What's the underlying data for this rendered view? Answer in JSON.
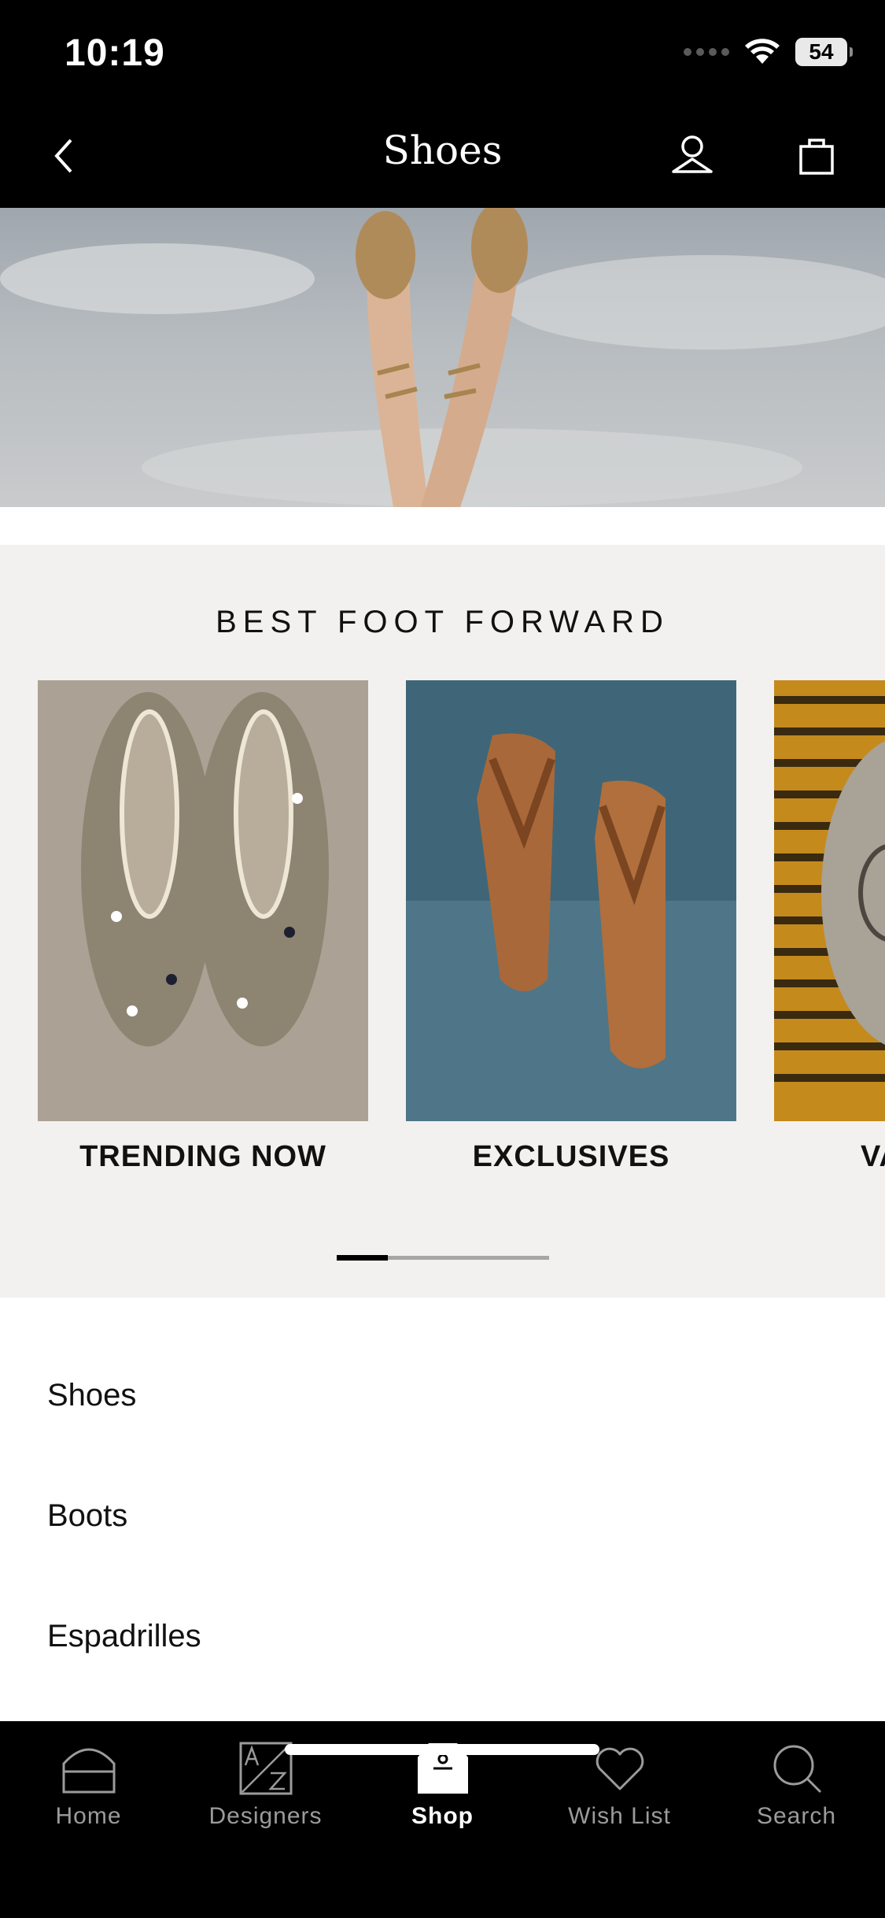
{
  "status_bar": {
    "time": "10:19",
    "battery": "54"
  },
  "nav": {
    "title": "Shoes"
  },
  "section": {
    "title": "BEST FOOT FORWARD"
  },
  "cards": [
    {
      "label": "TRENDING NOW"
    },
    {
      "label": "EXCLUSIVES"
    },
    {
      "label": "VA"
    }
  ],
  "categories": [
    "Shoes",
    "Boots",
    "Espadrilles"
  ],
  "tabs": [
    {
      "label": "Home",
      "icon": "home-icon",
      "active": false
    },
    {
      "label": "Designers",
      "icon": "designers-az-icon",
      "active": false
    },
    {
      "label": "Shop",
      "icon": "shop-bag-icon",
      "active": true
    },
    {
      "label": "Wish List",
      "icon": "heart-icon",
      "active": false
    },
    {
      "label": "Search",
      "icon": "search-icon",
      "active": false
    }
  ],
  "carousel_progress": 0.24,
  "colors": {
    "bars": "#000000",
    "section_bg": "#f2f1ef",
    "inactive_tab": "#9b9b9b"
  }
}
